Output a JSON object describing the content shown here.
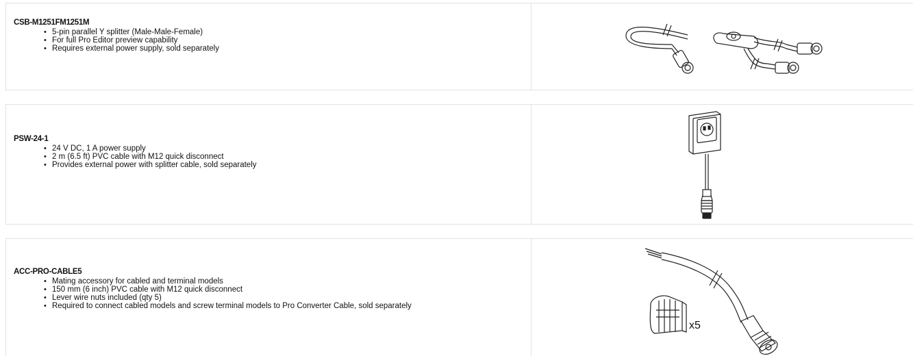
{
  "products": [
    {
      "part_number": "CSB-M1251FM1251M",
      "features": [
        "5-pin parallel Y splitter (Male-Male-Female)",
        "For full Pro Editor preview capability",
        "Requires external power supply, sold separately"
      ],
      "image_icon": "y-splitter-cable-icon"
    },
    {
      "part_number": "PSW-24-1",
      "features": [
        "24 V DC, 1 A power supply",
        "2 m (6.5 ft) PVC cable with M12 quick disconnect",
        "Provides external power with splitter cable, sold separately"
      ],
      "image_icon": "power-supply-icon"
    },
    {
      "part_number": "ACC-PRO-CABLE5",
      "features": [
        "Mating accessory for cabled and terminal models",
        "150 mm (6 inch) PVC cable with M12 quick disconnect",
        "Lever wire nuts included (qty 5)",
        "Required to connect cabled models and screw terminal models to Pro Converter Cable, sold separately"
      ],
      "image_icon": "cable-with-wire-nuts-icon",
      "image_label": "x5"
    }
  ]
}
